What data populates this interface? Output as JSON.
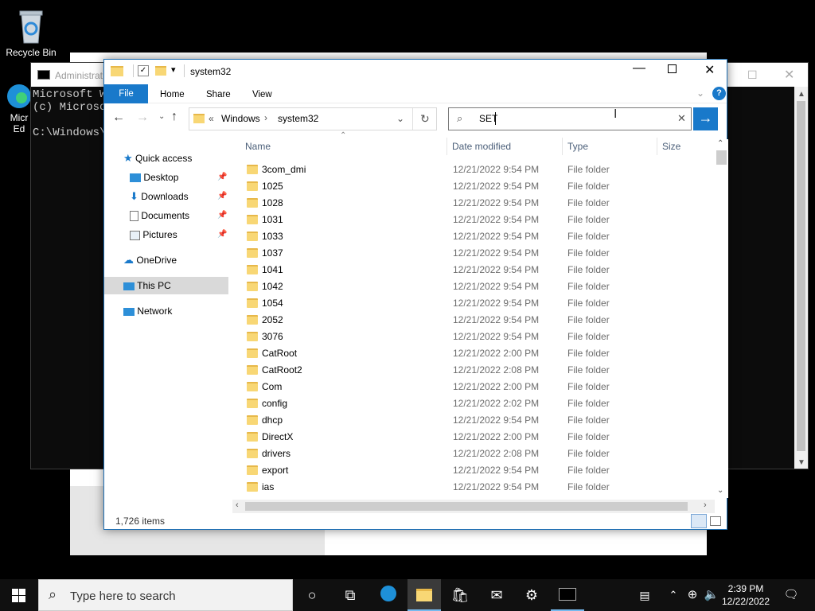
{
  "desktop": {
    "recycle_bin_label": "Recycle Bin",
    "edge_label_line1": "Micr",
    "edge_label_line2": "Ed"
  },
  "cmd_window": {
    "title": "Administrat",
    "lines": [
      "Microsoft W",
      "(c) Microso",
      "",
      "C:\\Windows\\"
    ]
  },
  "explorer": {
    "title": "system32",
    "ribbon_tabs": [
      "File",
      "Home",
      "Share",
      "View"
    ],
    "breadcrumb": {
      "prefix": "«",
      "parts": [
        "Windows",
        "system32"
      ]
    },
    "search_value": "SET",
    "columns": {
      "name": "Name",
      "date": "Date modified",
      "type": "Type",
      "size": "Size"
    },
    "nav": {
      "quick_access": "Quick access",
      "desktop": "Desktop",
      "downloads": "Downloads",
      "documents": "Documents",
      "pictures": "Pictures",
      "onedrive": "OneDrive",
      "this_pc": "This PC",
      "network": "Network"
    },
    "files": [
      {
        "name": "3com_dmi",
        "date": "12/21/2022 9:54 PM",
        "type": "File folder"
      },
      {
        "name": "1025",
        "date": "12/21/2022 9:54 PM",
        "type": "File folder"
      },
      {
        "name": "1028",
        "date": "12/21/2022 9:54 PM",
        "type": "File folder"
      },
      {
        "name": "1031",
        "date": "12/21/2022 9:54 PM",
        "type": "File folder"
      },
      {
        "name": "1033",
        "date": "12/21/2022 9:54 PM",
        "type": "File folder"
      },
      {
        "name": "1037",
        "date": "12/21/2022 9:54 PM",
        "type": "File folder"
      },
      {
        "name": "1041",
        "date": "12/21/2022 9:54 PM",
        "type": "File folder"
      },
      {
        "name": "1042",
        "date": "12/21/2022 9:54 PM",
        "type": "File folder"
      },
      {
        "name": "1054",
        "date": "12/21/2022 9:54 PM",
        "type": "File folder"
      },
      {
        "name": "2052",
        "date": "12/21/2022 9:54 PM",
        "type": "File folder"
      },
      {
        "name": "3076",
        "date": "12/21/2022 9:54 PM",
        "type": "File folder"
      },
      {
        "name": "CatRoot",
        "date": "12/21/2022 2:00 PM",
        "type": "File folder"
      },
      {
        "name": "CatRoot2",
        "date": "12/21/2022 2:08 PM",
        "type": "File folder"
      },
      {
        "name": "Com",
        "date": "12/21/2022 2:00 PM",
        "type": "File folder"
      },
      {
        "name": "config",
        "date": "12/21/2022 2:02 PM",
        "type": "File folder"
      },
      {
        "name": "dhcp",
        "date": "12/21/2022 9:54 PM",
        "type": "File folder"
      },
      {
        "name": "DirectX",
        "date": "12/21/2022 2:00 PM",
        "type": "File folder"
      },
      {
        "name": "drivers",
        "date": "12/21/2022 2:08 PM",
        "type": "File folder"
      },
      {
        "name": "export",
        "date": "12/21/2022 9:54 PM",
        "type": "File folder"
      },
      {
        "name": "ias",
        "date": "12/21/2022 9:54 PM",
        "type": "File folder"
      }
    ],
    "status_count": "1,726 items"
  },
  "taskbar": {
    "search_placeholder": "Type here to search",
    "time": "2:39 PM",
    "date": "12/22/2022"
  },
  "colors": {
    "accent": "#1979ca",
    "folder": "#f8d775",
    "taskbar": "#101010"
  }
}
